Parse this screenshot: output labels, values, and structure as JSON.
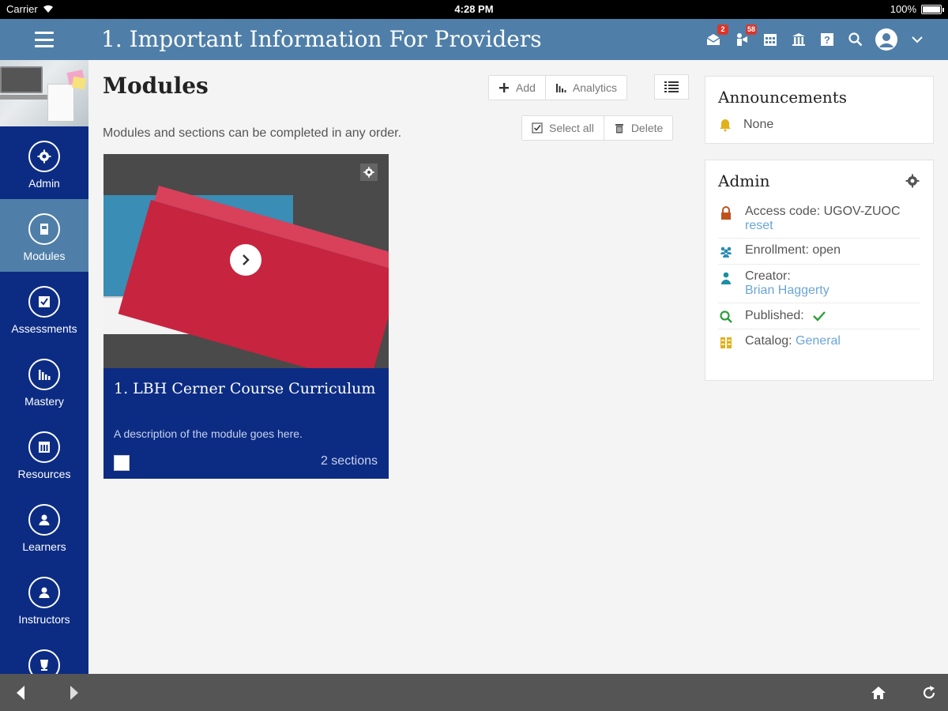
{
  "status_bar": {
    "carrier": "Carrier",
    "time": "4:28 PM",
    "battery": "100%"
  },
  "header": {
    "title": "1. Important Information For Providers",
    "badges": {
      "messages": "2",
      "notifications": "58"
    }
  },
  "sidebar": {
    "items": [
      {
        "label": "Admin",
        "icon": "gear-icon"
      },
      {
        "label": "Modules",
        "icon": "document-icon"
      },
      {
        "label": "Assessments",
        "icon": "checkbox-icon"
      },
      {
        "label": "Mastery",
        "icon": "bar-chart-icon"
      },
      {
        "label": "Resources",
        "icon": "calendar-icon"
      },
      {
        "label": "Learners",
        "icon": "person-icon"
      },
      {
        "label": "Instructors",
        "icon": "person-icon"
      }
    ]
  },
  "main": {
    "title": "Modules",
    "subtext": "Modules and sections can be completed in any order.",
    "toolbar": {
      "add_label": "Add",
      "analytics_label": "Analytics"
    },
    "actions": {
      "select_all_label": "Select all",
      "delete_label": "Delete"
    },
    "module": {
      "title": "1. LBH Cerner Course Curriculum",
      "description": "A description of the module goes here.",
      "sections": "2 sections"
    }
  },
  "announcements": {
    "title": "Announcements",
    "value": "None"
  },
  "admin": {
    "title": "Admin",
    "access_code": "Access code: UGOV-ZUOC",
    "reset_label": "reset",
    "enrollment": "Enrollment: open",
    "creator_label": "Creator:",
    "creator_name": "Brian Haggerty",
    "published_label": "Published:",
    "catalog_label": "Catalog:",
    "catalog_value": "General"
  },
  "colors": {
    "header": "#4f7fa8",
    "sidebar": "#0c2c84",
    "link": "#6aa6d6",
    "check": "#2e9e3b",
    "badge": "#d9362b"
  }
}
